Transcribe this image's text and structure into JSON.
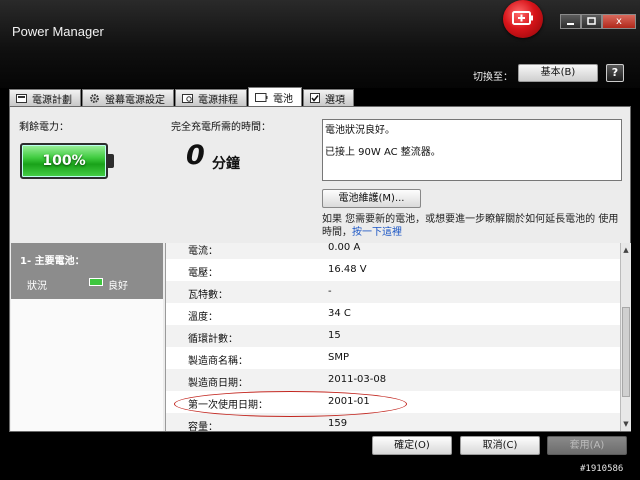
{
  "window": {
    "title": "Power Manager",
    "switch_label": "切換至：",
    "profile_value": "基本(B)",
    "help_label": "?",
    "close_label": "x"
  },
  "tabs": [
    {
      "label": "電源計劃",
      "icon": "power-plan-icon"
    },
    {
      "label": "螢幕電源設定",
      "icon": "gear-icon"
    },
    {
      "label": "電源排程",
      "icon": "clock-icon"
    },
    {
      "label": "電池",
      "icon": "battery-icon",
      "active": true
    },
    {
      "label": "選項",
      "icon": "checkbox-icon"
    }
  ],
  "battery": {
    "remaining_label": "剩餘電力：",
    "percent_text": "100%",
    "percent_value": 100,
    "fullcharge_label": "完全充電所需的時間：",
    "time_value": "0",
    "time_unit": "分鐘",
    "status_line1": "電池狀況良好。",
    "status_line2": "已接上 90W AC 整流器。",
    "maintenance_button": "電池維護(M)...",
    "note_text": "如果 您需要新的電池，或想要進一步瞭解關於如何延長電池的 使用時間，",
    "note_link": "按一下這裡"
  },
  "left_panel": {
    "title": "1- 主要電池：",
    "status_label": "狀況",
    "status_value": "良好"
  },
  "details": [
    {
      "key": "電流：",
      "value": "0.00 A"
    },
    {
      "key": "電壓：",
      "value": "16.48 V"
    },
    {
      "key": "瓦特數：",
      "value": "-"
    },
    {
      "key": "溫度：",
      "value": "34 C"
    },
    {
      "key": "循環計數：",
      "value": "15"
    },
    {
      "key": "製造商名稱：",
      "value": "SMP"
    },
    {
      "key": "製造商日期：",
      "value": "2011-03-08"
    },
    {
      "key": "第一次使用日期：",
      "value": "2001-01"
    },
    {
      "key": "容量：",
      "value": "159"
    }
  ],
  "buttons": {
    "ok": "確定(O)",
    "cancel": "取消(C)",
    "apply": "套用(A)"
  },
  "watermark": "#1910586",
  "colors": {
    "accent_red": "#d8141a",
    "battery_green": "#3fcb3f",
    "highlight_ellipse": "#c2261f",
    "link": "#1a55c4"
  }
}
